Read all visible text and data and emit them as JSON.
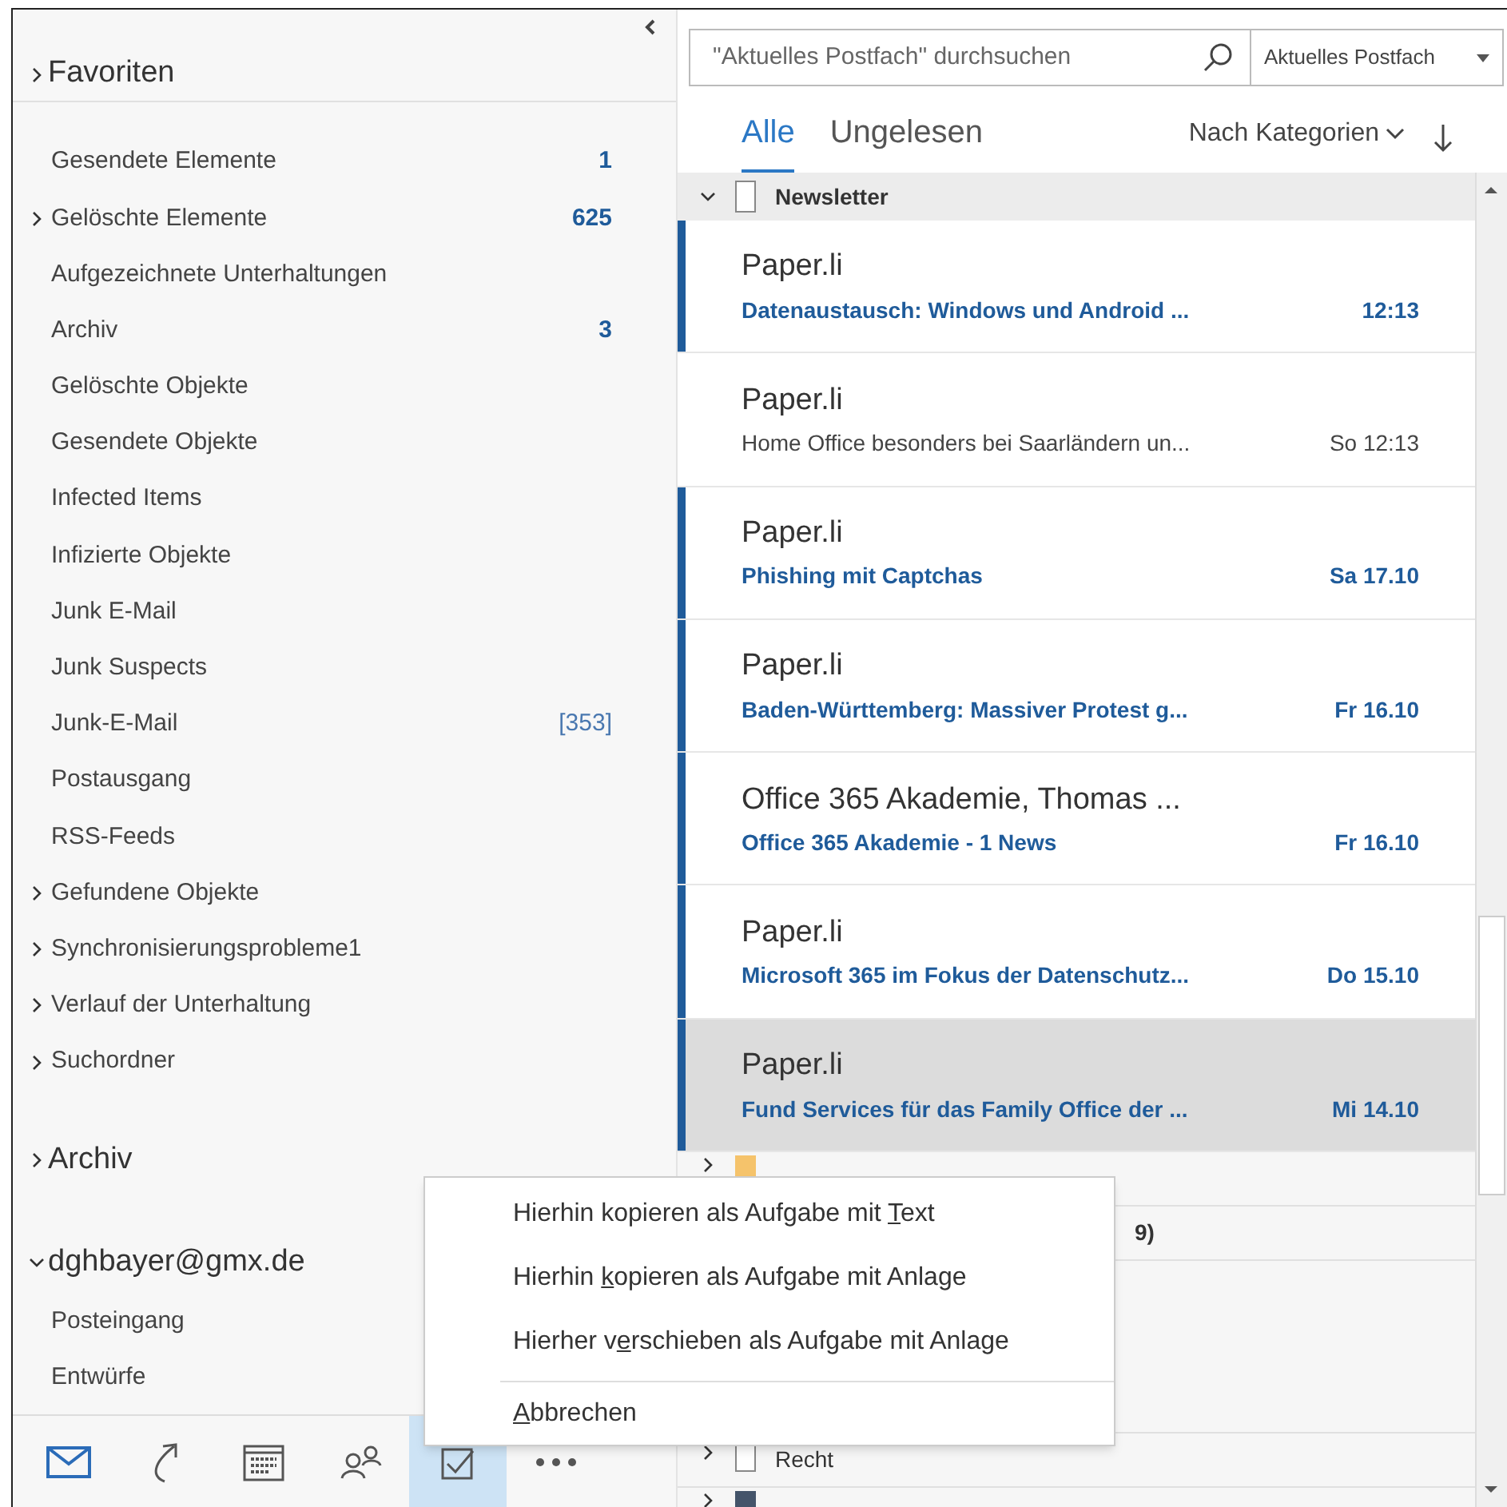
{
  "favorites": {
    "label": "Favoriten",
    "expanded": false
  },
  "folders": [
    {
      "name": "Gesendete Elemente",
      "count": "1",
      "count_bold": true,
      "has_children": false
    },
    {
      "name": "Gelöschte Elemente",
      "count": "625",
      "count_bold": true,
      "has_children": true
    },
    {
      "name": "Aufgezeichnete Unterhaltungen",
      "has_children": false
    },
    {
      "name": "Archiv",
      "count": "3",
      "count_bold": true,
      "has_children": false
    },
    {
      "name": "Gelöschte Objekte",
      "has_children": false
    },
    {
      "name": "Gesendete Objekte",
      "has_children": false
    },
    {
      "name": "Infected Items",
      "has_children": false
    },
    {
      "name": "Infizierte Objekte",
      "has_children": false
    },
    {
      "name": "Junk E-Mail",
      "has_children": false
    },
    {
      "name": "Junk Suspects",
      "has_children": false
    },
    {
      "name": "Junk-E-Mail",
      "count": "[353]",
      "count_bold": false,
      "has_children": false
    },
    {
      "name": "Postausgang",
      "has_children": false
    },
    {
      "name": "RSS-Feeds",
      "has_children": false
    },
    {
      "name": "Gefundene Objekte",
      "has_children": true
    },
    {
      "name": "Synchronisierungsprobleme1",
      "has_children": true
    },
    {
      "name": "Verlauf der Unterhaltung",
      "has_children": true
    },
    {
      "name": "Suchordner",
      "has_children": true
    }
  ],
  "sections": [
    {
      "label": "Archiv",
      "expanded": false
    },
    {
      "label": "dghbayer@gmx.de",
      "expanded": true,
      "folders": [
        {
          "name": "Posteingang"
        },
        {
          "name": "Entwürfe"
        }
      ]
    }
  ],
  "nav": [
    {
      "kind": "mail",
      "selected": true,
      "hovered": false
    },
    {
      "kind": "share",
      "selected": false,
      "hovered": false
    },
    {
      "kind": "calendar",
      "selected": false,
      "hovered": false
    },
    {
      "kind": "people",
      "selected": false,
      "hovered": false
    },
    {
      "kind": "tasks",
      "selected": false,
      "hovered": true
    },
    {
      "kind": "more",
      "selected": false,
      "hovered": false
    }
  ],
  "search": {
    "placeholder": "\"Aktuelles Postfach\" durchsuchen",
    "scope": "Aktuelles Postfach"
  },
  "tabs": [
    {
      "label": "Alle",
      "selected": true
    },
    {
      "label": "Ungelesen",
      "selected": false
    }
  ],
  "sort": {
    "label": "Nach Kategorien"
  },
  "category": {
    "label": "Newsletter",
    "expanded": true
  },
  "messages": [
    {
      "sender": "Paper.li",
      "subject": "Datenaustausch: Windows und Android ...",
      "time": "12:13",
      "unread": true,
      "selected": false
    },
    {
      "sender": "Paper.li",
      "subject": "Home Office besonders bei Saarländern un...",
      "time": "So 12:13",
      "unread": false,
      "selected": false
    },
    {
      "sender": "Paper.li",
      "subject": "Phishing mit Captchas",
      "time": "Sa 17.10",
      "unread": true,
      "selected": false
    },
    {
      "sender": "Paper.li",
      "subject": "Baden-Württemberg: Massiver Protest g...",
      "time": "Fr 16.10",
      "unread": true,
      "selected": false
    },
    {
      "sender": "Office 365 Akademie, Thomas ...",
      "subject": "Office 365 Akademie - 1 News",
      "time": "Fr 16.10",
      "unread": true,
      "selected": false
    },
    {
      "sender": "Paper.li",
      "subject": "Microsoft 365 im Fokus der Datenschutz...",
      "time": "Do 15.10",
      "unread": true,
      "selected": false
    },
    {
      "sender": "Paper.li",
      "subject": "Fund Services für das Family Office der ...",
      "time": "Mi 14.10",
      "unread": true,
      "selected": true
    }
  ],
  "more_categories": [
    {
      "kind": "colored",
      "color": "#f5c36b"
    },
    {
      "kind": "covered",
      "label": "9)"
    },
    {
      "kind": "plain",
      "label": "Recht"
    },
    {
      "kind": "colored",
      "color": "#44546a"
    }
  ],
  "context_menu": {
    "items": [
      {
        "before": "Hierhin kopieren als Aufgabe mit ",
        "key": "T",
        "after": "ext"
      },
      {
        "before": "Hierhin ",
        "key": "k",
        "after": "opieren als Aufgabe mit Anlage"
      },
      {
        "before": "Hierher v",
        "key": "e",
        "after": "rschieben als Aufgabe mit Anlage"
      }
    ],
    "cancel": {
      "key": "A",
      "after": "bbrechen"
    }
  }
}
